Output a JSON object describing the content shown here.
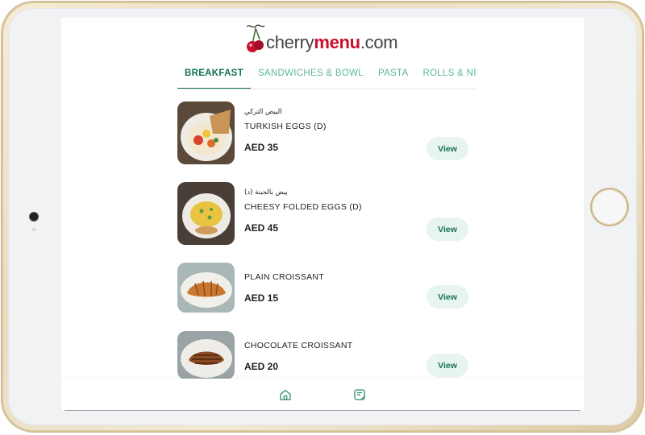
{
  "brand": {
    "logo_main": "cherry",
    "logo_bold": "menu",
    "logo_suffix": ".com",
    "primary_color": "#11705a",
    "accent_color": "#5cb896",
    "cherry_color": "#c8102e"
  },
  "tabs": [
    {
      "label": "BREAKFAST",
      "active": true
    },
    {
      "label": "SANDWICHES & BOWL",
      "active": false
    },
    {
      "label": "PASTA",
      "active": false
    },
    {
      "label": "ROLLS & NIGIRI",
      "active": false
    }
  ],
  "items": [
    {
      "arabic": "البيض التركي",
      "name": "TURKISH EGGS (D)",
      "price": "AED 35",
      "button": "View"
    },
    {
      "arabic": "بيض بالجبنة (د)",
      "name": "CHEESY FOLDED EGGS (D)",
      "price": "AED 45",
      "button": "View"
    },
    {
      "arabic": "",
      "name": "PLAIN CROISSANT",
      "price": "AED 15",
      "button": "View"
    },
    {
      "arabic": "",
      "name": "CHOCOLATE CROISSANT",
      "price": "AED 20",
      "button": "View"
    }
  ],
  "bottom_nav": [
    {
      "icon": "home-icon"
    },
    {
      "icon": "menu-card-icon"
    }
  ]
}
